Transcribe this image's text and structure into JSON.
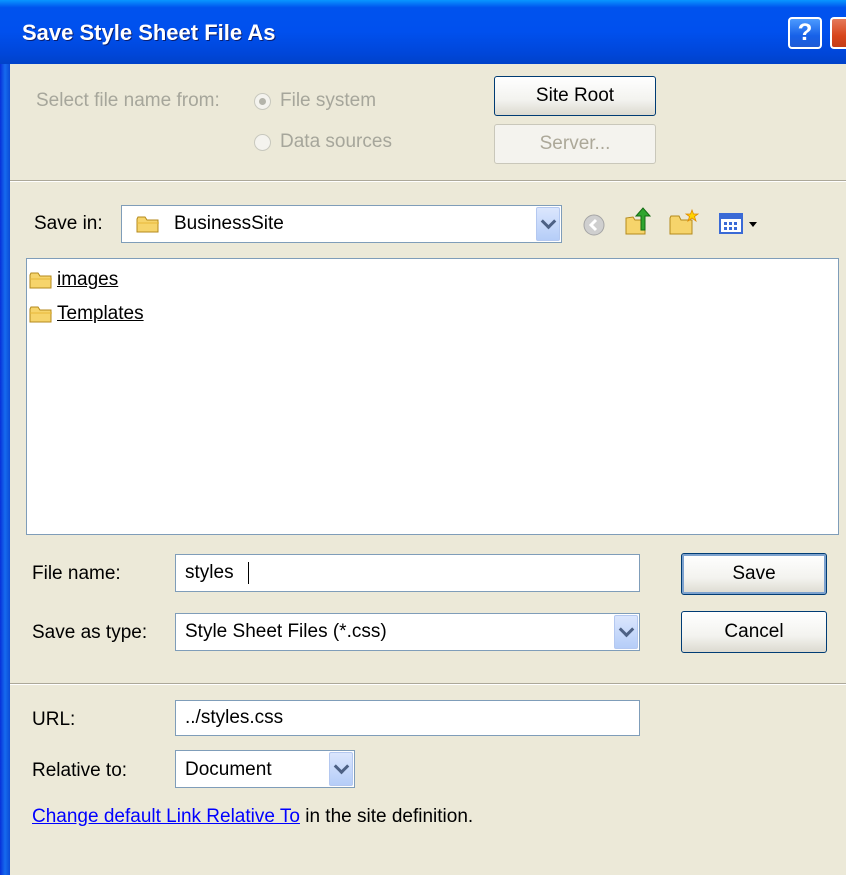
{
  "window": {
    "title": "Save Style Sheet File As",
    "help_label": "?"
  },
  "source": {
    "label": "Select file name from:",
    "options": [
      "File system",
      "Data sources"
    ],
    "selected": "File system",
    "site_root_label": "Site Root",
    "server_label": "Server..."
  },
  "save_in": {
    "label": "Save in:",
    "value": "BusinessSite",
    "toolbar_icons": [
      "back-icon",
      "up-folder-icon",
      "new-folder-icon",
      "view-menu-icon"
    ]
  },
  "files": [
    {
      "name": "images",
      "icon": "folder-icon"
    },
    {
      "name": "Templates",
      "icon": "folder-icon"
    }
  ],
  "file_name": {
    "label": "File name:",
    "value": "styles"
  },
  "save_as_type": {
    "label": "Save as type:",
    "value": "Style Sheet Files (*.css)"
  },
  "buttons": {
    "save": "Save",
    "cancel": "Cancel"
  },
  "url": {
    "label": "URL:",
    "value": "../styles.css"
  },
  "relative_to": {
    "label": "Relative to:",
    "value": "Document"
  },
  "footer": {
    "link": "Change default Link Relative To",
    "text": " in the site definition."
  }
}
